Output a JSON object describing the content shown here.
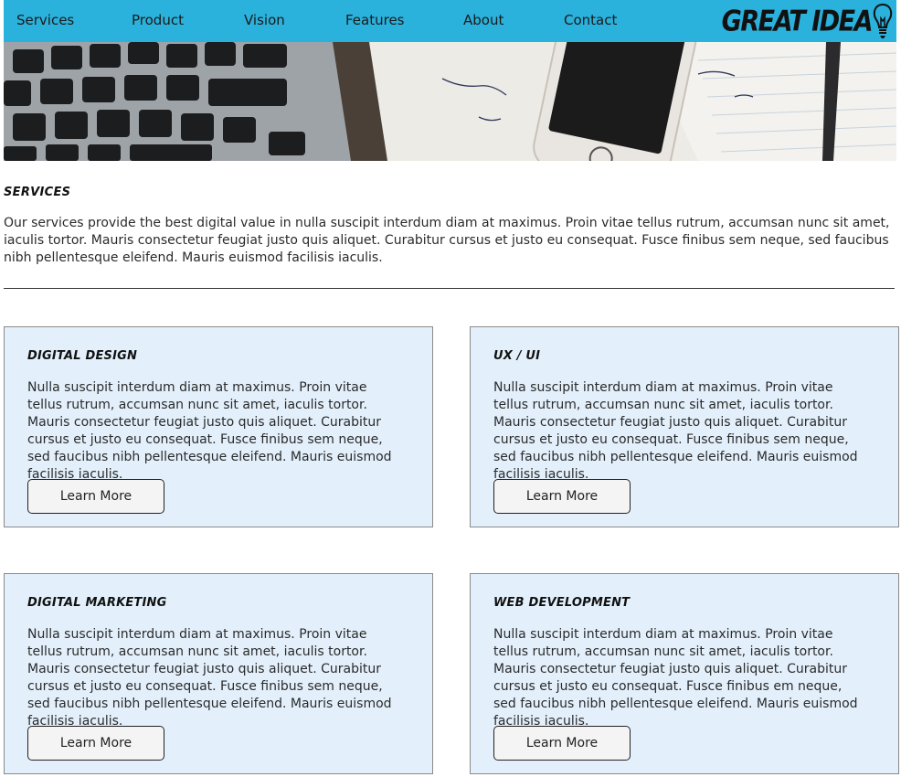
{
  "nav": {
    "items": [
      {
        "label": "Services"
      },
      {
        "label": "Product"
      },
      {
        "label": "Vision"
      },
      {
        "label": "Features"
      },
      {
        "label": "About"
      },
      {
        "label": "Contact"
      }
    ],
    "logo_text": "GREAT IDEA",
    "logo_icon": "lightbulb-icon"
  },
  "hero": {
    "image": "desk-laptop-phone-notebook-photo"
  },
  "intro": {
    "title": "Services",
    "text": "Our services provide the best digital value in nulla suscipit interdum diam at maximus. Proin vitae tellus rutrum, accumsan nunc sit amet, iaculis tortor. Mauris consectetur feugiat justo quis aliquet. Curabitur cursus et justo eu consequat. Fusce finibus sem neque, sed faucibus nibh pellentesque eleifend. Mauris euismod facilisis iaculis."
  },
  "cards": [
    {
      "title": "Digital Design",
      "text": "Nulla suscipit interdum diam at maximus. Proin vitae tellus rutrum, accumsan nunc sit amet, iaculis tortor. Mauris consectetur feugiat justo quis aliquet. Curabitur cursus et justo eu consequat. Fusce finibus sem neque, sed faucibus nibh pellentesque eleifend. Mauris euismod facilisis iaculis.",
      "button": "Learn More"
    },
    {
      "title": "UX / UI",
      "text": "Nulla suscipit interdum diam at maximus. Proin vitae tellus rutrum, accumsan nunc sit amet, iaculis tortor. Mauris consectetur feugiat justo quis aliquet. Curabitur cursus et justo eu consequat. Fusce finibus sem neque, sed faucibus nibh pellentesque eleifend. Mauris euismod facilisis iaculis.",
      "button": "Learn More"
    },
    {
      "title": "Digital Marketing",
      "text": "Nulla suscipit interdum diam at maximus. Proin vitae tellus rutrum, accumsan nunc sit amet, iaculis tortor. Mauris consectetur feugiat justo quis aliquet. Curabitur cursus et justo eu consequat. Fusce finibus sem neque, sed faucibus nibh pellentesque eleifend. Mauris euismod facilisis iaculis.",
      "button": "Learn More"
    },
    {
      "title": "Web Development",
      "text": "Nulla suscipit interdum diam at maximus. Proin vitae tellus rutrum, accumsan nunc sit amet, iaculis tortor. Mauris consectetur feugiat justo quis aliquet. Curabitur cursus et justo eu consequat. Fusce finibus em neque, sed faucibus nibh pellentesque eleifend. Mauris euismod facilisis iaculis.",
      "button": "Learn More"
    }
  ],
  "colors": {
    "nav_bg": "#2ab1dc",
    "card_bg": "#e3f0fb",
    "card_border": "#8a8a8a",
    "text": "#2a2a2a"
  }
}
